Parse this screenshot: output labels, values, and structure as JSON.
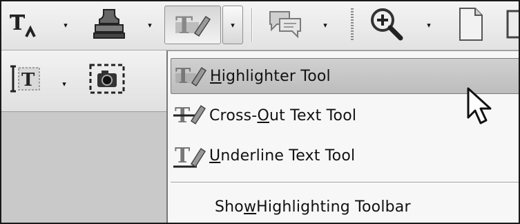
{
  "toolbar": {
    "text_edit_icon": "text-insert-icon",
    "stamp_icon": "stamp-icon",
    "highlight_icon": "highlighter-icon",
    "comment_icon": "comment-icon",
    "zoom_icon": "zoom-in-icon",
    "page_icon": "page-icon",
    "dropdown_glyph": "▾"
  },
  "toolbar2": {
    "select_text_icon": "select-text-icon",
    "snapshot_icon": "snapshot-icon",
    "dropdown_glyph": "▾"
  },
  "menu": {
    "items": [
      {
        "icon": "highlighter-tool-icon",
        "pre": "",
        "u": "H",
        "post": "ighlighter Tool",
        "selected": true
      },
      {
        "icon": "cross-out-text-icon",
        "pre": "Cross-",
        "u": "O",
        "post": "ut Text Tool",
        "selected": false
      },
      {
        "icon": "underline-text-icon",
        "pre": "",
        "u": "U",
        "post": "nderline Text Tool",
        "selected": false
      },
      {
        "icon": "",
        "pre": "Sho",
        "u": "w",
        "post": " Highlighting Toolbar",
        "selected": false
      }
    ]
  },
  "colors": {
    "selected_bg": "#c6c6c6",
    "menu_bg": "#f7f7f7",
    "toolbar_bg": "#e8e8e8"
  }
}
